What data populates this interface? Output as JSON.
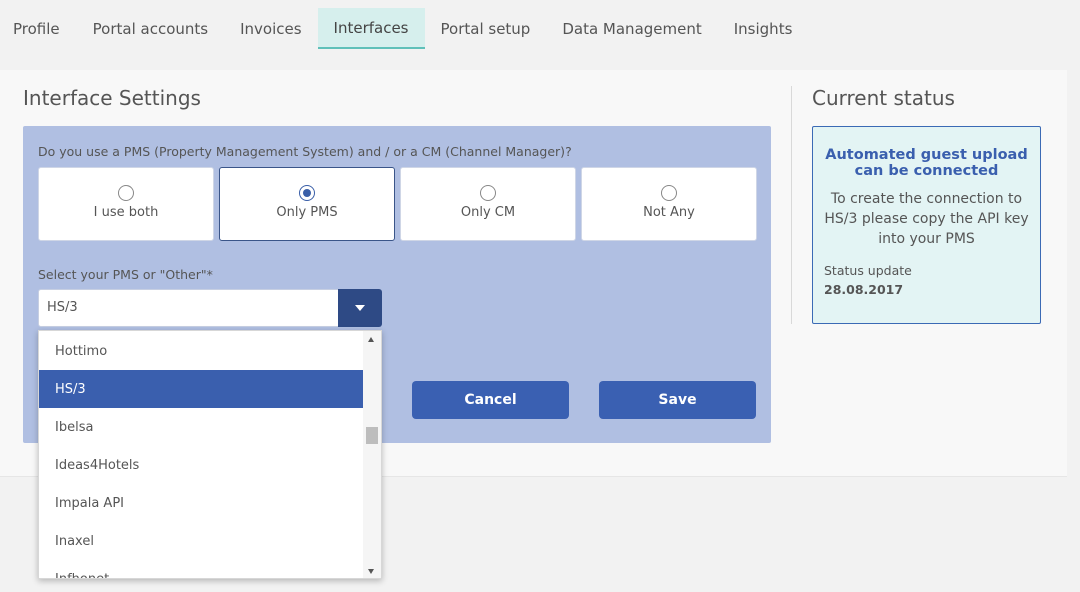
{
  "tabs": [
    {
      "label": "Profile"
    },
    {
      "label": "Portal accounts"
    },
    {
      "label": "Invoices"
    },
    {
      "label": "Interfaces",
      "active": true
    },
    {
      "label": "Portal setup"
    },
    {
      "label": "Data Management"
    },
    {
      "label": "Insights"
    }
  ],
  "settings": {
    "title": "Interface Settings",
    "question": "Do you use a PMS (Property Management System) and / or a CM (Channel Manager)?",
    "options": [
      {
        "label": "I use both",
        "selected": false
      },
      {
        "label": "Only PMS",
        "selected": true
      },
      {
        "label": "Only CM",
        "selected": false
      },
      {
        "label": "Not Any",
        "selected": false
      }
    ],
    "select_label": "Select your PMS or \"Other\"*",
    "selected_pms": "HS/3",
    "cancel_label": "Cancel",
    "save_label": "Save"
  },
  "dropdown": {
    "items": [
      "Hottimo",
      "HS/3",
      "Ibelsa",
      "Ideas4Hotels",
      "Impala API",
      "Inaxel",
      "Infhonet"
    ],
    "selected_index": 1
  },
  "status": {
    "title": "Current status",
    "card_title": "Automated guest upload can be connected",
    "card_text": "To create the connection to HS/3 please copy the API key into your PMS",
    "update_label": "Status update",
    "update_date": "28.08.2017"
  },
  "colors": {
    "accent": "#3a60b2",
    "tab_active_bg": "#d6efed",
    "form_bg": "#b0bfe2",
    "status_bg": "#e3f4f4"
  }
}
